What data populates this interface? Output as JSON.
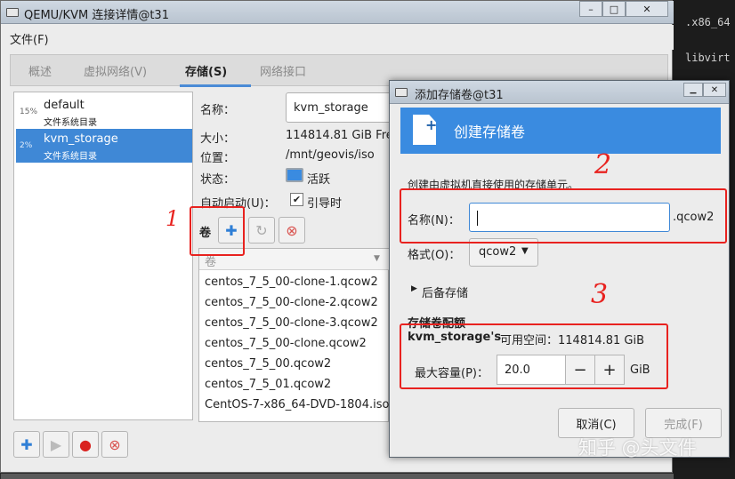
{
  "terminal": {
    "line1": ".x86_64",
    "line2": "libvirt"
  },
  "main_window": {
    "title": "QEMU/KVM 连接详情@t31",
    "controls": [
      "–",
      "□",
      "✕"
    ],
    "menu": {
      "file": "文件(F)"
    },
    "tabs": [
      {
        "label": "概述"
      },
      {
        "label": "虚拟网络(V)"
      },
      {
        "label": "存储(S)"
      },
      {
        "label": "网络接口"
      }
    ],
    "pools": [
      {
        "pct": "15%",
        "name": "default",
        "type": "文件系统目录"
      },
      {
        "pct": "2%",
        "name": "kvm_storage",
        "type": "文件系统目录"
      }
    ],
    "details": {
      "name_label": "名称：",
      "name_value": "kvm_storage",
      "size_label": "大小：",
      "size_value": "114814.81 GiB Fre",
      "location_label": "位置：",
      "location_value": "/mnt/geovis/iso",
      "state_label": "状态：",
      "state_value": "活跃",
      "autostart_label": "自动启动(U)：",
      "autostart_value": "引导时"
    },
    "volumes_label": "卷",
    "volumes_header": "卷",
    "volumes": [
      "centos_7_5_00-clone-1.qcow2",
      "centos_7_5_00-clone-2.qcow2",
      "centos_7_5_00-clone-3.qcow2",
      "centos_7_5_00-clone.qcow2",
      "centos_7_5_00.qcow2",
      "centos_7_5_01.qcow2",
      "CentOS-7-x86_64-DVD-1804.iso"
    ]
  },
  "dialog": {
    "title": "添加存储卷@t31",
    "header": "创建存储卷",
    "description": "创建由虚拟机直接使用的存储单元。",
    "name_label": "名称(N)：",
    "name_value": "",
    "name_suffix": ".qcow2",
    "format_label": "格式(O)：",
    "format_value": "qcow2",
    "backing_store": "后备存储",
    "quota_heading": "存储卷配额",
    "space_pool": "kvm_storage's",
    "space_text": "可用空间：114814.81 GiB",
    "capacity_label": "最大容量(P)：",
    "capacity_value": "20.0",
    "capacity_unit": "GiB",
    "cancel": "取消(C)",
    "finish": "完成(F)",
    "controls": [
      "▁",
      "✕"
    ]
  },
  "annotations": {
    "n1": "1",
    "n2": "2",
    "n3": "3"
  },
  "watermark": "知乎 @头文件",
  "colors": {
    "accent": "#3a8be0",
    "annotation": "#e8221f",
    "selection": "#3f88d6"
  }
}
